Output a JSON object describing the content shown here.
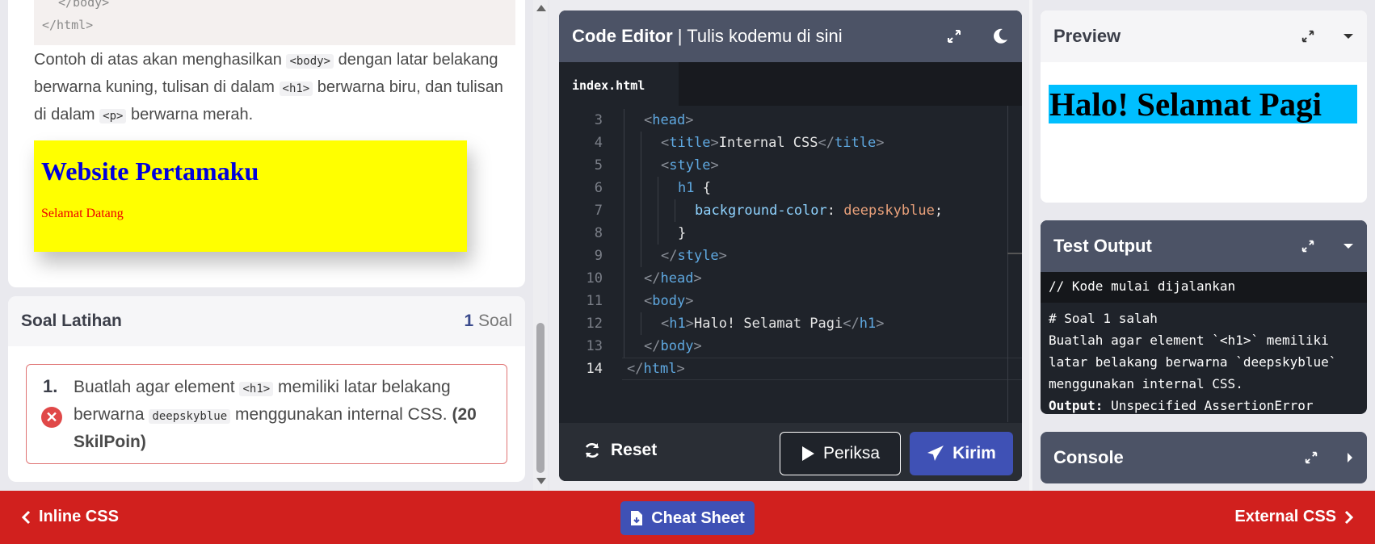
{
  "lesson": {
    "snippet_close_body": "</body>",
    "snippet_close_html": "</html>",
    "text_part1": "Contoh di atas akan menghasilkan",
    "code_body": "<body>",
    "text_part2": "dengan latar belakang berwarna kuning, tulisan di dalam",
    "code_h1": "<h1>",
    "text_part3": "berwarna biru, dan tulisan di dalam",
    "code_p": "<p>",
    "text_part4": "berwarna merah.",
    "demo_heading": "Website Pertamaku",
    "demo_paragraph": "Selamat Datang"
  },
  "soal": {
    "title": "Soal Latihan",
    "count_number": "1",
    "count_label": "Soal",
    "item_number": "1.",
    "item_text_1": "Buatlah agar element",
    "item_code_1": "<h1>",
    "item_text_2": "memiliki latar belakang berwarna",
    "item_code_2": "deepskyblue",
    "item_text_3": "menggunakan internal CSS.",
    "item_points": "(20 SkilPoin)",
    "status": "salah"
  },
  "editor": {
    "title_bold": "Code Editor",
    "title_sep": " | ",
    "title_sub": "Tulis kodemu di sini",
    "tab": "index.html",
    "reset_label": "Reset",
    "periksa_label": "Periksa",
    "kirim_label": "Kirim",
    "lines": [
      {
        "n": "3",
        "indent": 1,
        "parts": [
          [
            "br",
            "<"
          ],
          [
            "tg",
            "head"
          ],
          [
            "br",
            ">"
          ]
        ]
      },
      {
        "n": "4",
        "indent": 2,
        "parts": [
          [
            "br",
            "<"
          ],
          [
            "tg",
            "title"
          ],
          [
            "br",
            ">"
          ],
          [
            "tx",
            "Internal CSS"
          ],
          [
            "br",
            "</"
          ],
          [
            "tg",
            "title"
          ],
          [
            "br",
            ">"
          ]
        ]
      },
      {
        "n": "5",
        "indent": 2,
        "parts": [
          [
            "br",
            "<"
          ],
          [
            "tg",
            "style"
          ],
          [
            "br",
            ">"
          ]
        ]
      },
      {
        "n": "6",
        "indent": 3,
        "parts": [
          [
            "tg",
            "h1"
          ],
          [
            "tx",
            " {"
          ]
        ]
      },
      {
        "n": "7",
        "indent": 4,
        "parts": [
          [
            "prop",
            "background-color"
          ],
          [
            "tx",
            ": "
          ],
          [
            "val",
            "deepskyblue"
          ],
          [
            "tx",
            ";"
          ]
        ]
      },
      {
        "n": "8",
        "indent": 3,
        "parts": [
          [
            "tx",
            "}"
          ]
        ]
      },
      {
        "n": "9",
        "indent": 2,
        "parts": [
          [
            "br",
            "</"
          ],
          [
            "tg",
            "style"
          ],
          [
            "br",
            ">"
          ]
        ]
      },
      {
        "n": "10",
        "indent": 1,
        "parts": [
          [
            "br",
            "</"
          ],
          [
            "tg",
            "head"
          ],
          [
            "br",
            ">"
          ]
        ]
      },
      {
        "n": "11",
        "indent": 1,
        "parts": [
          [
            "br",
            "<"
          ],
          [
            "tg",
            "body"
          ],
          [
            "br",
            ">"
          ]
        ]
      },
      {
        "n": "12",
        "indent": 2,
        "parts": [
          [
            "br",
            "<"
          ],
          [
            "tg",
            "h1"
          ],
          [
            "br",
            ">"
          ],
          [
            "tx",
            "Halo! Selamat Pagi"
          ],
          [
            "br",
            "</"
          ],
          [
            "tg",
            "h1"
          ],
          [
            "br",
            ">"
          ]
        ]
      },
      {
        "n": "13",
        "indent": 1,
        "parts": [
          [
            "br",
            "</"
          ],
          [
            "tg",
            "body"
          ],
          [
            "br",
            ">"
          ]
        ]
      },
      {
        "n": "14",
        "indent": 0,
        "parts": [
          [
            "br",
            "</"
          ],
          [
            "tg",
            "html"
          ],
          [
            "br",
            ">"
          ]
        ]
      }
    ]
  },
  "preview": {
    "title": "Preview",
    "heading": "Halo! Selamat Pagi",
    "heading_bg": "#00bfff"
  },
  "test_output": {
    "title": "Test Output",
    "start_line": "// Kode mulai dijalankan",
    "result_header": "# Soal 1 salah",
    "message": "Buatlah agar element `<h1>` memiliki latar belakang berwarna `deepskyblue` menggunakan internal CSS.",
    "output_label": "Output:",
    "output_value": "Unspecified AssertionError"
  },
  "console": {
    "title": "Console"
  },
  "bottom_nav": {
    "prev": "Inline CSS",
    "cheat_sheet": "Cheat Sheet",
    "next": "External CSS"
  },
  "icons": {
    "expand": "expand-icon",
    "moon": "moon-icon",
    "dropdown": "chevron-down-icon",
    "chevron_right": "chevron-right-icon",
    "reset": "refresh-icon",
    "play": "play-icon",
    "send": "paper-plane-icon",
    "error": "x-circle-icon",
    "file": "file-icon"
  },
  "colors": {
    "accent": "#3f51b5",
    "bottom_bar": "#d1201e",
    "panel_header": "#4c5366",
    "error": "#e04848"
  }
}
